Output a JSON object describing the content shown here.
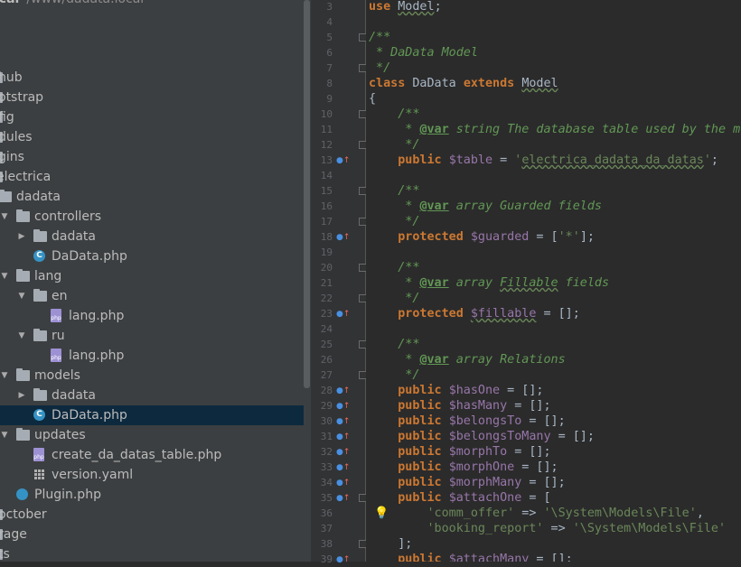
{
  "project_header": {
    "title": "ical",
    "path": "/www/dadata.local"
  },
  "tree": [
    {
      "label": "hub",
      "icon": "folder",
      "x": 0
    },
    {
      "label": "otstrap",
      "icon": "folder",
      "x": 0
    },
    {
      "label": "fig",
      "icon": "folder",
      "x": 0
    },
    {
      "label": "dules",
      "icon": "folder",
      "x": 0
    },
    {
      "label": "gins",
      "icon": "folder",
      "x": 0
    },
    {
      "label": "electrica",
      "icon": "folder",
      "x": 0
    },
    {
      "label": "dadata",
      "icon": "folder",
      "x": 1
    },
    {
      "label": "controllers",
      "icon": "folder",
      "x": 2,
      "expanded": true
    },
    {
      "label": "dadata",
      "icon": "folder",
      "x": 3,
      "expanded": false
    },
    {
      "label": "DaData.php",
      "icon": "class",
      "x": 3
    },
    {
      "label": "lang",
      "icon": "folder",
      "x": 2,
      "expanded": true
    },
    {
      "label": "en",
      "icon": "folder",
      "x": 3,
      "expanded": true
    },
    {
      "label": "lang.php",
      "icon": "php",
      "x": 4
    },
    {
      "label": "ru",
      "icon": "folder",
      "x": 3,
      "expanded": true
    },
    {
      "label": "lang.php",
      "icon": "php",
      "x": 4
    },
    {
      "label": "models",
      "icon": "folder",
      "x": 2,
      "expanded": true
    },
    {
      "label": "dadata",
      "icon": "folder",
      "x": 3,
      "expanded": false
    },
    {
      "label": "DaData.php",
      "icon": "class",
      "x": 3,
      "selected": true
    },
    {
      "label": "updates",
      "icon": "folder",
      "x": 2,
      "expanded": true
    },
    {
      "label": "create_da_datas_table.php",
      "icon": "php",
      "x": 3
    },
    {
      "label": "version.yaml",
      "icon": "yaml",
      "x": 3
    },
    {
      "label": "Plugin.php",
      "icon": "plugin",
      "x": 2
    },
    {
      "label": "october",
      "icon": "folder",
      "x": 0
    },
    {
      "label": "rage",
      "icon": "folder",
      "x": 0
    },
    {
      "label": "ts",
      "icon": "folder",
      "x": 0
    }
  ],
  "code_lines": [
    {
      "n": "3",
      "html": "<span class=\"kw\">use</span> <span class=\"squig\">Model</span>;"
    },
    {
      "n": "4",
      "html": ""
    },
    {
      "n": "5",
      "html": "<span class=\"cmt\">/**</span>"
    },
    {
      "n": "6",
      "html": "<span class=\"cmt\"> * DaData Model</span>"
    },
    {
      "n": "7",
      "html": "<span class=\"cmt\"> */</span>"
    },
    {
      "n": "8",
      "html": "<span class=\"kw\">class</span> DaData <span class=\"kw\">extends</span> <span class=\"squig\">Model</span>"
    },
    {
      "n": "9",
      "html": "{"
    },
    {
      "n": "10",
      "html": "    <span class=\"cmt\">/**</span>"
    },
    {
      "n": "11",
      "html": "<span class=\"cmt\">     * </span><span class=\"tag\">@var</span><span class=\"cmt\"> string The database table used by the model.</span>"
    },
    {
      "n": "12",
      "html": "<span class=\"cmt\">     */</span>"
    },
    {
      "n": "13",
      "html": "    <span class=\"kw\">public</span> <span class=\"var\">$table</span> = <span class=\"str\">'</span><span class=\"str squig\">electrica_dadata_da_datas</span><span class=\"str\">'</span>;"
    },
    {
      "n": "14",
      "html": ""
    },
    {
      "n": "15",
      "html": "    <span class=\"cmt\">/**</span>"
    },
    {
      "n": "16",
      "html": "<span class=\"cmt\">     * </span><span class=\"tag\">@var</span><span class=\"cmt\"> array Guarded fields</span>"
    },
    {
      "n": "17",
      "html": "<span class=\"cmt\">     */</span>"
    },
    {
      "n": "18",
      "html": "    <span class=\"kw\">protected</span> <span class=\"var\">$guarded</span> = [<span class=\"str\">'*'</span>];"
    },
    {
      "n": "19",
      "html": ""
    },
    {
      "n": "20",
      "html": "    <span class=\"cmt\">/**</span>"
    },
    {
      "n": "21",
      "html": "<span class=\"cmt\">     * </span><span class=\"tag\">@var</span><span class=\"cmt\"> array </span><span class=\"cmt squig\">Fillable</span><span class=\"cmt\"> fields</span>"
    },
    {
      "n": "22",
      "html": "<span class=\"cmt\">     */</span>"
    },
    {
      "n": "23",
      "html": "    <span class=\"kw\">protected</span> <span class=\"var squig\">$fillable</span> = [];"
    },
    {
      "n": "24",
      "html": ""
    },
    {
      "n": "25",
      "html": "    <span class=\"cmt\">/**</span>"
    },
    {
      "n": "26",
      "html": "<span class=\"cmt\">     * </span><span class=\"tag\">@var</span><span class=\"cmt\"> array Relations</span>"
    },
    {
      "n": "27",
      "html": "<span class=\"cmt\">     */</span>"
    },
    {
      "n": "28",
      "html": "    <span class=\"kw\">public</span> <span class=\"var\">$hasOne</span> = [];"
    },
    {
      "n": "29",
      "html": "    <span class=\"kw\">public</span> <span class=\"var\">$hasMany</span> = [];"
    },
    {
      "n": "30",
      "html": "    <span class=\"kw\">public</span> <span class=\"var\">$belongsTo</span> = [];"
    },
    {
      "n": "31",
      "html": "    <span class=\"kw\">public</span> <span class=\"var\">$belongsToMany</span> = [];"
    },
    {
      "n": "32",
      "html": "    <span class=\"kw\">public</span> <span class=\"var\">$morphTo</span> = [];"
    },
    {
      "n": "33",
      "html": "    <span class=\"kw\">public</span> <span class=\"var\">$morphOne</span> = [];"
    },
    {
      "n": "34",
      "html": "    <span class=\"kw\">public</span> <span class=\"var\">$morphMany</span> = [];"
    },
    {
      "n": "35",
      "html": "    <span class=\"kw\">public</span> <span class=\"var\">$attachOne</span> = ["
    },
    {
      "n": "36",
      "html": "        <span class=\"str\">'comm_offer'</span> => <span class=\"str\">'\\System\\Models\\File'</span>,"
    },
    {
      "n": "37",
      "html": "        <span class=\"str\">'booking_report'</span> => <span class=\"str\">'\\System\\Models\\File'</span>"
    },
    {
      "n": "38",
      "html": "    ];"
    },
    {
      "n": "39",
      "html": "    <span class=\"kw\">public</span> <span class=\"var\">$attachMany</span> = [];"
    }
  ],
  "override_lines": [
    "13",
    "18",
    "23",
    "28",
    "29",
    "30",
    "31",
    "32",
    "33",
    "34",
    "35",
    "39"
  ],
  "fold_lines": [
    "5",
    "7",
    "10",
    "12",
    "15",
    "17",
    "20",
    "22",
    "25",
    "27",
    "35",
    "38"
  ],
  "highlight_line": "36",
  "bulb_line": "36",
  "colors": {
    "keyword": "#cc7832",
    "comment": "#629755",
    "string": "#6a8759",
    "variable": "#9876aa",
    "selection": "#0d293e"
  }
}
